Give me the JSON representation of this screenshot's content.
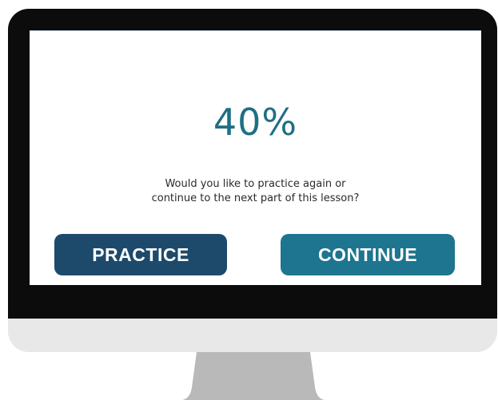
{
  "result": {
    "score": "40%",
    "prompt_line1": "Would you like to practice again or",
    "prompt_line2": "continue to the next part of this lesson?"
  },
  "actions": {
    "practice_label": "PRACTICE",
    "continue_label": "CONTINUE"
  },
  "colors": {
    "score": "#1f6f84",
    "practice_button": "#1d4a6b",
    "continue_button": "#1d7590",
    "bezel": "#0c0c0c",
    "chin": "#e8e8e8",
    "stand": "#b9b9b9"
  }
}
